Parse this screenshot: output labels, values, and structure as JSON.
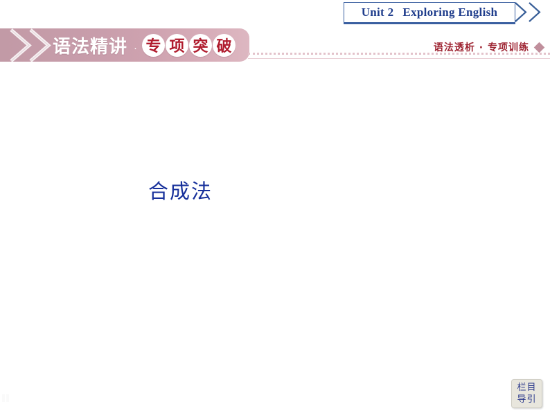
{
  "header": {
    "unit_label": "Unit 2",
    "unit_title": "Exploring English",
    "accent_color": "#1f3d8c"
  },
  "banner": {
    "white_text": "语法精讲",
    "separator": "·",
    "circled_chars": [
      "专",
      "项",
      "突",
      "破"
    ],
    "bg_color": "#c29aa6",
    "circle_text_color": "#b01c2e"
  },
  "subtitle": {
    "text": "语法透析 · 专项训练",
    "color": "#9e2432",
    "diamond_color": "#c08f9c"
  },
  "main": {
    "heading": "合成法",
    "heading_color": "#17309b"
  },
  "nav_button": {
    "line1": "栏目",
    "line2": "导引",
    "text_color": "#2c3a8c",
    "bg_color": "#e8e6dd"
  }
}
